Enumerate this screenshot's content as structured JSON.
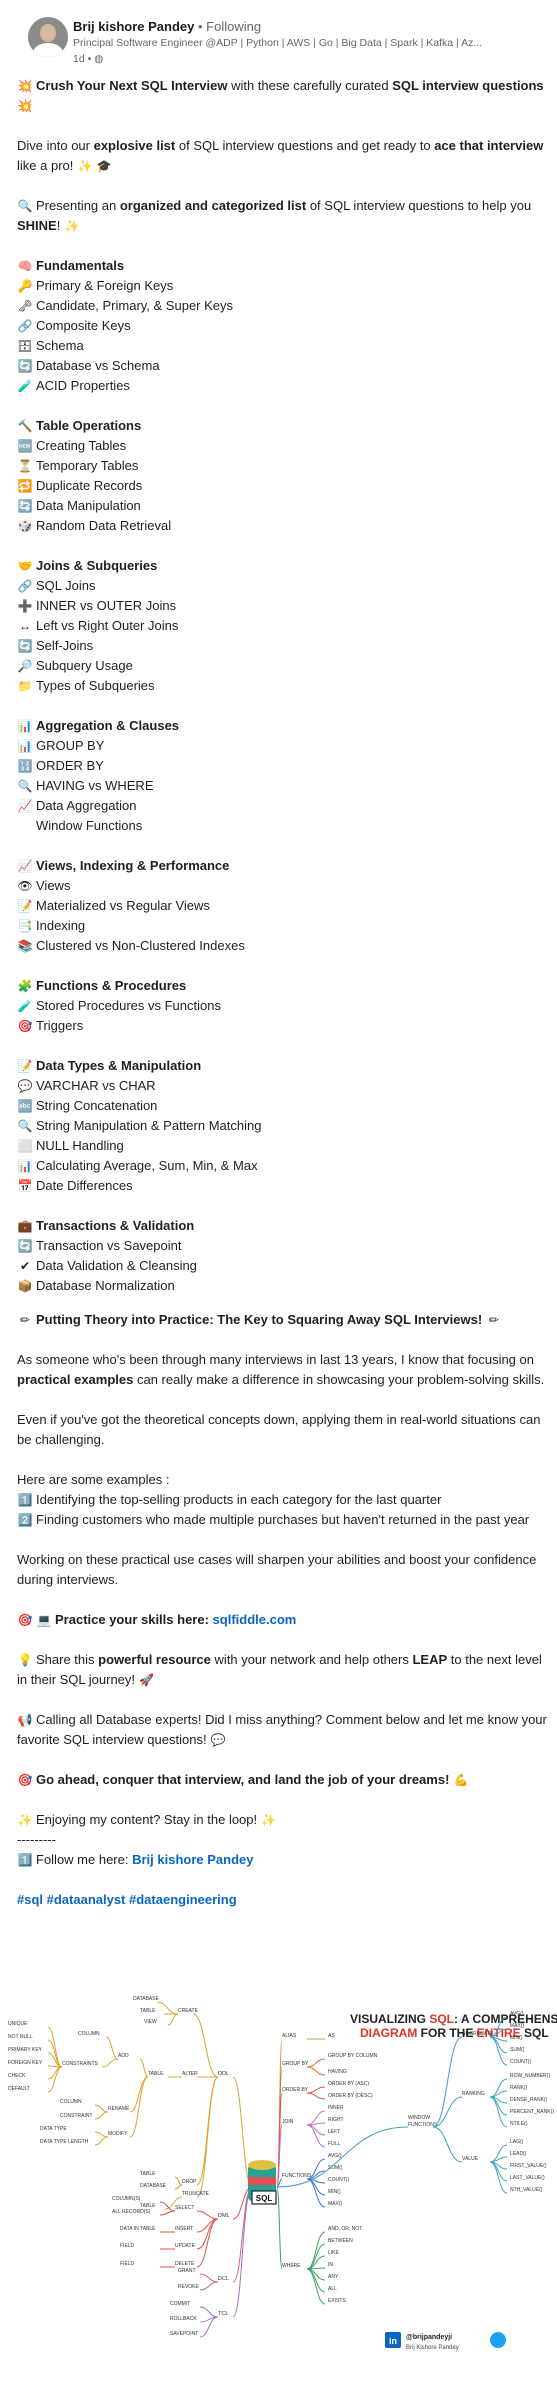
{
  "header": {
    "name": "Brij kishore Pandey",
    "follow": "• Following",
    "subtitle": "Principal Software Engineer @ADP | Python | AWS | Go | Big Data | Spark | Kafka | Az...",
    "time": "1d •"
  },
  "intro": {
    "crush_pre": "Crush Your Next SQL Interview",
    "crush_mid": " with these carefully curated ",
    "crush_bold": "SQL interview questions",
    "dive_pre": "Dive into our ",
    "dive_bold1": "explosive list",
    "dive_mid": " of SQL interview questions and get ready to ",
    "dive_bold2": "ace that interview",
    "dive_post": " like a pro!",
    "present_pre": "Presenting an ",
    "present_bold": "organized and categorized list",
    "present_mid": " of SQL interview questions to help you ",
    "present_bold2": "SHINE",
    "present_post": "!"
  },
  "sections": [
    {
      "title": "Fundamentals",
      "items": [
        "Primary & Foreign Keys",
        "Candidate, Primary, & Super Keys",
        "Composite Keys",
        "Schema",
        "Database vs Schema",
        "ACID Properties"
      ]
    },
    {
      "title": "Table Operations",
      "items": [
        "Creating Tables",
        "Temporary Tables",
        "Duplicate Records",
        "Data Manipulation",
        "Random Data Retrieval"
      ]
    },
    {
      "title": "Joins & Subqueries",
      "items": [
        "SQL Joins",
        "INNER vs OUTER Joins",
        "Left vs Right Outer Joins",
        "Self-Joins",
        "Subquery Usage",
        "Types of Subqueries"
      ]
    },
    {
      "title": "Aggregation & Clauses",
      "items": [
        "GROUP BY",
        "ORDER BY",
        "HAVING vs WHERE",
        "Data Aggregation",
        "Window Functions"
      ]
    },
    {
      "title": "Views, Indexing & Performance",
      "items": [
        "Views",
        "Materialized vs Regular Views",
        "Indexing",
        "Clustered vs Non-Clustered Indexes"
      ]
    },
    {
      "title": "Functions & Procedures",
      "items": [
        "Stored Procedures vs Functions",
        "Triggers"
      ]
    },
    {
      "title": "Data Types & Manipulation",
      "items": [
        "VARCHAR vs CHAR",
        "String Concatenation",
        "String Manipulation & Pattern Matching",
        "NULL Handling",
        "Calculating Average, Sum, Min, & Max",
        "Date Differences"
      ]
    },
    {
      "title": "Transactions & Validation",
      "items": [
        "Transaction vs Savepoint",
        "Data Validation & Cleansing",
        "Database Normalization"
      ]
    }
  ],
  "practice": {
    "heading": "Putting Theory into Practice: The Key to Squaring Away SQL Interviews!",
    "p1_pre": "As someone who's been through many interviews in last 13 years, I know that focusing on ",
    "p1_bold": "practical examples",
    "p1_post": " can really make a difference in showcasing your problem-solving skills.",
    "p2": "Even if you've got the theoretical concepts down, applying them in real-world situations can be challenging.",
    "examples_label": "Here are some examples :",
    "ex1": "Identifying the top-selling products in each category for the last quarter",
    "ex2": "Finding customers who made multiple purchases but haven't returned in the past year",
    "p3": "Working on these practical use cases will sharpen your abilities and boost your confidence during interviews.",
    "skills_label": "Practice your skills here:",
    "skills_link": "sqlfiddle.com",
    "share_pre": "Share this ",
    "share_bold": "powerful resource",
    "share_mid": " with your network and help others ",
    "share_bold2": "LEAP",
    "share_post": " to the next level in their SQL journey!",
    "calling": "Calling all Database experts! Did I miss anything? Comment below and let me know your favorite SQL interview questions!",
    "goahead": "Go ahead, conquer that interview, and land the job of your dreams!",
    "enjoy": "Enjoying my content? Stay in the loop!",
    "dashes": "---------",
    "follow_pre": "Follow me here: ",
    "follow_link": "Brij kishore Pandey",
    "hashtags": "#sql #dataanalyst #dataengineering"
  },
  "diagram": {
    "title1_a": "VISUALIZING ",
    "title1_b": "SQL",
    "title1_c": ": A COMPREHENSIVE",
    "title2_a": "DIAGRAM",
    "title2_b": " FOR THE ",
    "title2_c": "ENTIRE",
    "title2_d": " SQL",
    "center": "SQL",
    "handle": "@brijpandeyji",
    "handle_name": "Brij Kishore Pandey",
    "nodes_left": [
      "DATABASE",
      "TABLE",
      "VIEW",
      "CREATE",
      "COLUMN",
      "UNIQUE",
      "NOT NULL",
      "PRIMARY KEY",
      "FOREIGN KEY",
      "CHECK",
      "DEFAULT",
      "CONSTRAINTS",
      "ADD",
      "TABLE",
      "ALTER",
      "DDL",
      "COLUMN",
      "CONSTRAINT",
      "RENAME",
      "DATA TYPE",
      "DATA TYPE LENGTH",
      "MODIFY",
      "TABLE",
      "DATABASE",
      "DROP",
      "TABLE",
      "TRUNCATE",
      "COLUMN(S)",
      "ALL RECORD(S)",
      "SELECT",
      "DATA IN TABLE",
      "INSERT",
      "FIELD",
      "UPDATE",
      "FIELD",
      "DELETE",
      "DML",
      "GRANT",
      "REVOKE",
      "DCL",
      "COMMIT",
      "ROLLBACK",
      "SAVEPOINT",
      "TCL"
    ],
    "nodes_right": [
      "ALIAS",
      "AS",
      "GROUP BY",
      "GROUP BY COLUMN",
      "HAVING",
      "ORDER BY",
      "ORDER BY (ASC)",
      "ORDER BY (DESC)",
      "JOIN",
      "INNER",
      "RIGHT",
      "LEFT",
      "FULL",
      "FUNCTIONS",
      "AVG()",
      "SUM()",
      "COUNT()",
      "MIN()",
      "MAX()",
      "WHERE",
      "AND, OR, NOT",
      "BETWEEN",
      "LIKE",
      "IN",
      "ANY",
      "ALL",
      "EXISTS",
      "WINDOW FUNCTIONS",
      "AGGREGATE",
      "AVG()",
      "MAX()",
      "MIN()",
      "SUM()",
      "COUNT()",
      "RANKING",
      "ROW_NUMBER()",
      "RANK()",
      "DENSE_RANK()",
      "PERCENT_RANK()",
      "NTILE()",
      "VALUE",
      "LAG()",
      "LEAD()",
      "FIRST_VALUE()",
      "LAST_VALUE()",
      "NTH_VALUE()"
    ]
  },
  "colors": {
    "link": "#0a66c2",
    "accent_red": "#e0342b",
    "text": "#1f1f1f",
    "muted": "#666666"
  }
}
